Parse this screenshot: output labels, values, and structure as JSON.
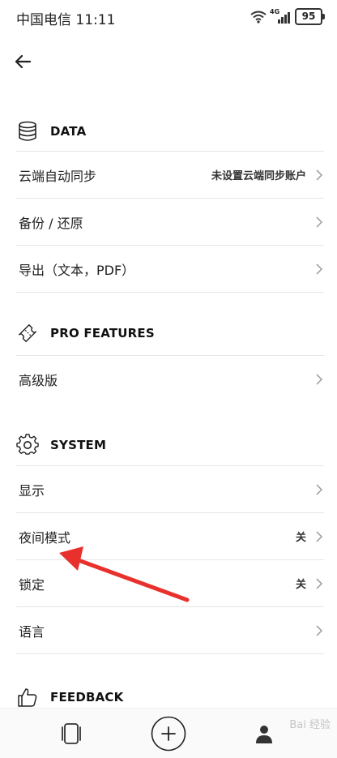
{
  "status_bar": {
    "carrier_time": "中国电信 11:11",
    "network": "4G",
    "battery": "95"
  },
  "sections": {
    "data": {
      "title": "DATA",
      "items": [
        {
          "label": "云端自动同步",
          "value": "未设置云端同步账户"
        },
        {
          "label": "备份 / 还原"
        },
        {
          "label": "导出（文本，PDF）"
        }
      ]
    },
    "pro": {
      "title": "PRO FEATURES",
      "items": [
        {
          "label": "高级版"
        }
      ]
    },
    "system": {
      "title": "SYSTEM",
      "items": [
        {
          "label": "显示"
        },
        {
          "label": "夜间模式",
          "value": "关"
        },
        {
          "label": "锁定",
          "value": "关"
        },
        {
          "label": "语言"
        }
      ]
    },
    "feedback": {
      "title": "FEEDBACK"
    }
  },
  "watermark": "Bai 经验",
  "colors": {
    "annotation_arrow": "#e8302c",
    "divider": "#e6e6e6"
  }
}
